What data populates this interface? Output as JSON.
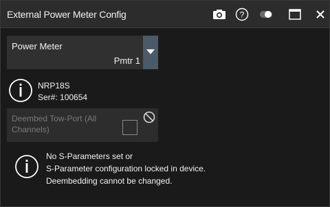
{
  "dialog": {
    "title": "External Power Meter Config",
    "icons": [
      "camera-icon",
      "help-icon",
      "toggle-icon",
      "maximize-icon",
      "close-icon"
    ]
  },
  "power_meter": {
    "label": "Power Meter",
    "selected": "Pmtr 1"
  },
  "sensor": {
    "name": "NRP18S",
    "serial": "Ser#: 100654"
  },
  "deembed": {
    "label": "Deembed Tow-Port (All Channels)",
    "checked": false,
    "enabled": false
  },
  "message": {
    "line1": "No S-Parameters set or",
    "line2": "S-Parameter configuration locked in device.",
    "line3": "Deembedding cannot be changed."
  },
  "colors": {
    "title_bg": "#2c2c2c",
    "panel_bg": "#303030",
    "dropdown_btn": "#4a5a68",
    "disabled_text": "#7a7a7a"
  }
}
